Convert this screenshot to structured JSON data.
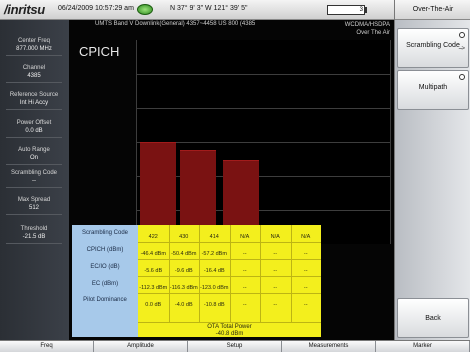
{
  "status": {
    "logo": "/inritsu",
    "datetime": "06/24/2009 10:57:29 am",
    "gps": "N 37° 9' 3\" W 121° 39' 5\"",
    "battery_label": "3",
    "battery_fraction": 0.0
  },
  "header": {
    "band": "UMTS Band V Downlink(General) 4357~4458 US 800 (4385",
    "mode1": "WCDMA/HSDPA",
    "mode2": "Over The Air",
    "title": "CPICH"
  },
  "params": [
    {
      "label": "Center Freq",
      "value": "877.000 MHz"
    },
    {
      "label": "Channel",
      "value": "4385"
    },
    {
      "label": "Reference Source",
      "value": "Int Hi Accy"
    },
    {
      "label": "Power Offset",
      "value": "0.0 dB"
    },
    {
      "label": "Auto Range",
      "value": "On"
    },
    {
      "label": "Scrambling Code",
      "value": "--"
    },
    {
      "label": "Max Spread",
      "value": "512"
    },
    {
      "label": "Threshold",
      "value": "-21.5 dB"
    }
  ],
  "bars": [
    {
      "code": "422",
      "level": 0.5
    },
    {
      "code": "430",
      "level": 0.46
    },
    {
      "code": "414",
      "level": 0.41
    }
  ],
  "table": {
    "row_labels": [
      "Scrambling Code",
      "CPICH (dBm)",
      "EC/IO (dB)",
      "EC (dBm)",
      "Pilot Dominance"
    ],
    "rows": [
      [
        "422",
        "430",
        "414",
        "N/A",
        "N/A",
        "N/A"
      ],
      [
        "-46.4 dBm",
        "-50.4 dBm",
        "-57.2 dBm",
        "--",
        "--",
        "--"
      ],
      [
        "-5.6 dB",
        "-9.6 dB",
        "-16.4 dB",
        "--",
        "--",
        "--"
      ],
      [
        "-112.3 dBm",
        "-116.3 dBm",
        "-123.0 dBm",
        "--",
        "--",
        "--"
      ],
      [
        "0.0 dB",
        "-4.0 dB",
        "-10.8 dB",
        "--",
        "--",
        "--"
      ]
    ],
    "ota_label": "OTA Total Power",
    "ota_value": "-40.8 dBm"
  },
  "right_panel": {
    "title": "Over-The-Air",
    "scrambling_code": "Scrambling Code",
    "scrambling_arrow": "--->",
    "multipath": "Multipath",
    "back": "Back"
  },
  "bottom_menu": [
    "Freq",
    "Amplitude",
    "Setup",
    "Measurements",
    "Marker"
  ],
  "colors": {
    "bar": "#7a1212",
    "table_yellow": "#f3ef1d",
    "table_label_blue": "#a7c9ea"
  }
}
